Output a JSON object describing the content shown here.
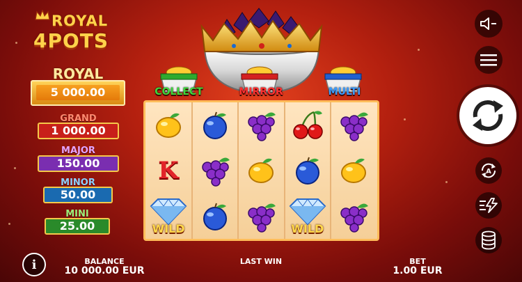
{
  "logo": {
    "line1": "ROYAL",
    "line2": "4POTS"
  },
  "jackpots": {
    "royal": {
      "label": "ROYAL",
      "value": "5 000.00"
    },
    "grand": {
      "label": "GRAND",
      "value": "1 000.00",
      "color": "#c8201a"
    },
    "major": {
      "label": "MAJOR",
      "value": "150.00",
      "color": "#7a2eb0"
    },
    "minor": {
      "label": "MINOR",
      "value": "50.00",
      "color": "#1a6ab0"
    },
    "mini": {
      "label": "MINI",
      "value": "25.00",
      "color": "#2a8a2a"
    }
  },
  "features": {
    "collect": {
      "label": "COLLECT",
      "color": "#3cd83c"
    },
    "mirror": {
      "label": "MIRROR",
      "color": "#ff3030"
    },
    "multi": {
      "label": "MULTI",
      "color": "#3a9cff"
    }
  },
  "reels": {
    "grid": [
      [
        "lemon",
        "plum",
        "grapes",
        "cherry",
        "grapes"
      ],
      [
        "k",
        "grapes",
        "lemon",
        "plum",
        "lemon"
      ],
      [
        "wild",
        "plum",
        "grapes",
        "wild",
        "grapes"
      ]
    ],
    "wild_label": "WILD",
    "k_label": "K"
  },
  "controls": {
    "sound_icon": "speaker-muted-icon",
    "menu_icon": "hamburger-menu-icon",
    "spin_icon": "spin-arrows-icon",
    "autoplay_icon": "autoplay-icon",
    "turbo_icon": "turbo-icon",
    "bet_icon": "coin-stack-icon",
    "info_label": "i"
  },
  "bottom": {
    "balance_label": "BALANCE",
    "balance_value": "10 000.00 EUR",
    "lastwin_label": "LAST WIN",
    "lastwin_value": "",
    "bet_label": "BET",
    "bet_value": "1.00 EUR"
  }
}
